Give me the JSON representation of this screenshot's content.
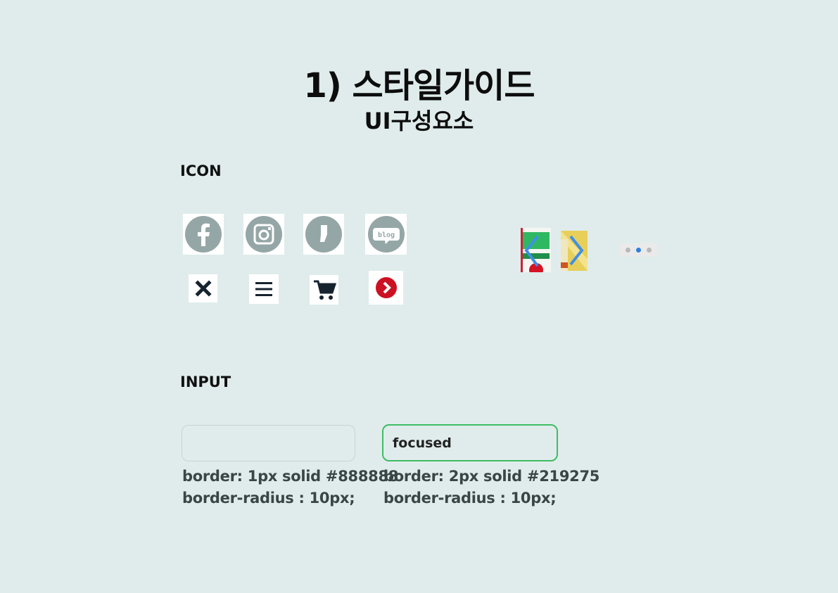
{
  "header": {
    "title": "1) 스타일가이드",
    "subtitle": "UI구성요소"
  },
  "sections": {
    "icon_label": "ICON",
    "input_label": "INPUT"
  },
  "icons": {
    "social": [
      "facebook-icon",
      "instagram-icon",
      "kakao-story-icon",
      "blog-icon"
    ],
    "ui": [
      "close-icon",
      "menu-icon",
      "cart-icon",
      "next-arrow-icon"
    ],
    "carousel": [
      "carousel-prev-thumbnail",
      "carousel-next-thumbnail"
    ],
    "colors": {
      "social_gray": "#95a6a6",
      "dark": "#16232f",
      "red": "#cc1122",
      "arrow_blue": "#3f8fe8",
      "dot_active": "#2e7fe0"
    }
  },
  "pagination": {
    "count": 3,
    "active_index": 1
  },
  "inputs": {
    "normal": {
      "value": "",
      "spec_line1": "border:  1px solid  #888888",
      "spec_line2": "border-radius : 10px;",
      "border_color": "#888888"
    },
    "focused": {
      "value": "focused",
      "spec_line1": "border: 2px solid  #219275",
      "spec_line2": "border-radius :  10px;",
      "border_color": "#219275"
    }
  }
}
